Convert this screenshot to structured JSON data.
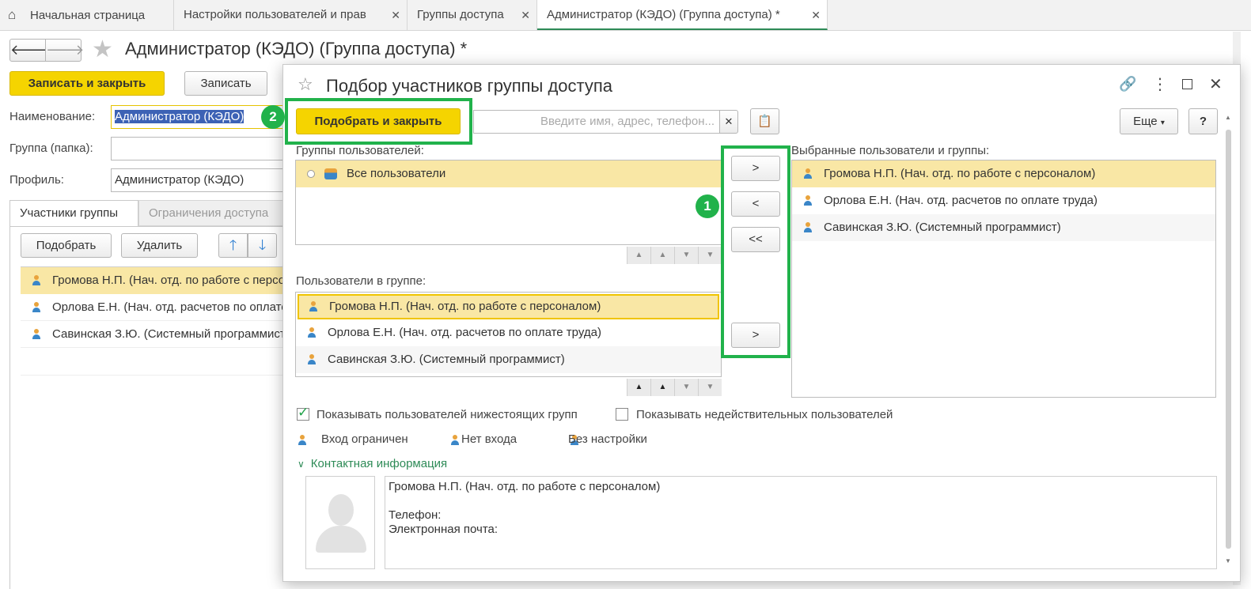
{
  "tabs": {
    "home": "Начальная страница",
    "tab1": "Настройки пользователей и прав",
    "tab2": "Группы доступа",
    "tab3": "Администратор (КЭДО) (Группа доступа) *"
  },
  "form": {
    "title": "Администратор (КЭДО) (Группа доступа) *",
    "save_close": "Записать и закрыть",
    "save": "Записать",
    "name_label": "Наименование:",
    "name_value": "Администратор (КЭДО)",
    "group_label": "Группа (папка):",
    "group_value": "",
    "profile_label": "Профиль:",
    "profile_value": "Администратор (КЭДО)",
    "tab_members": "Участники группы",
    "tab_restrictions": "Ограничения доступа",
    "pick": "Подобрать",
    "delete": "Удалить",
    "members": [
      "Громова Н.П. (Нач. отд. по работе с персоналом)",
      "Орлова Е.Н. (Нач. отд. расчетов по оплате труда)",
      "Савинская З.Ю. (Системный программист)"
    ]
  },
  "dialog": {
    "title": "Подбор участников группы доступа",
    "pick_close": "Подобрать и закрыть",
    "search_placeholder": "Введите имя, адрес, телефон...",
    "more": "Еще",
    "help": "?",
    "groups_label": "Группы пользователей:",
    "groups": [
      "Все пользователи"
    ],
    "users_label": "Пользователи в группе:",
    "users": [
      "Громова Н.П. (Нач. отд. по работе с персоналом)",
      "Орлова Е.Н. (Нач. отд. расчетов по оплате труда)",
      "Савинская З.Ю. (Системный программист)"
    ],
    "selected_label": "Выбранные пользователи и группы:",
    "selected": [
      "Громова Н.П. (Нач. отд. по работе с персоналом)",
      "Орлова Е.Н. (Нач. отд. расчетов по оплате труда)",
      "Савинская З.Ю. (Системный программист)"
    ],
    "btn_add": ">",
    "btn_remove": "<",
    "btn_remove_all": "<<",
    "btn_add_user": ">",
    "show_subgroups": "Показывать пользователей нижестоящих групп",
    "show_subgroups_checked": true,
    "show_invalid": "Показывать недействительных пользователей",
    "show_invalid_checked": false,
    "legend_restricted": "Вход ограничен",
    "legend_no_login": "Нет входа",
    "legend_no_settings": "Без настройки",
    "contact_header": "Контактная информация",
    "contact_name": "Громова Н.П. (Нач. отд. по работе с персоналом)",
    "contact_phone": "Телефон:",
    "contact_email": "Электронная почта:"
  },
  "badges": {
    "one": "1",
    "two": "2"
  },
  "colors": {
    "accent_yellow": "#f5d400",
    "highlight": "#21b24b",
    "selection": "#f9e7a5"
  }
}
